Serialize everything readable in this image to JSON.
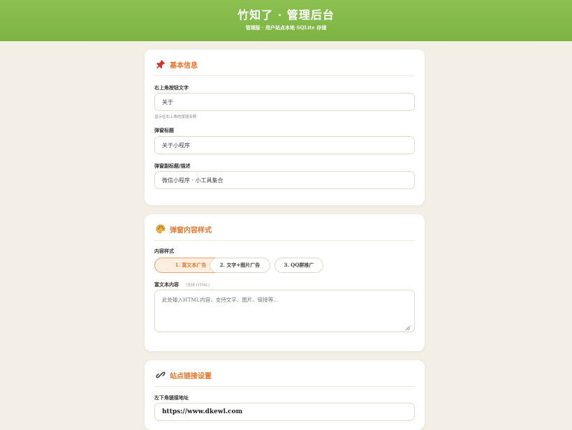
{
  "header": {
    "title": "竹知了 · 管理后台",
    "subtitle": "管理版 · 用户站点本地 SQLite 存储"
  },
  "basic": {
    "section_title": "基本信息",
    "section_icon": "pushpin-icon",
    "btn_text_label": "右上角按钮文字",
    "btn_text_value": "关于",
    "btn_text_hint": "显示在右上角的按钮名称",
    "popup_title_label": "弹窗标题",
    "popup_title_value": "关于小程序",
    "popup_sub_label": "弹窗副标题/描述",
    "popup_sub_value": "微信小程序 · 小工具集合"
  },
  "popup": {
    "section_title": "弹窗内容样式",
    "section_icon": "palette-icon",
    "style_label": "内容样式",
    "options": [
      "1. 富文本广告",
      "2. 文字+图片广告",
      "3. QQ群推广"
    ],
    "selected": 0,
    "rich_label": "富文本内容",
    "rich_hint": "（支持 HTML）",
    "rich_placeholder": "此处输入HTML内容，支持文字、图片、链接等..."
  },
  "links": {
    "section_title": "站点链接设置",
    "section_icon": "link-icon",
    "url_label": "左下角链接地址",
    "url_value": "https://www.dkewl.com"
  },
  "colors": {
    "header_green": "#7cb342",
    "accent_orange": "#e8762a",
    "page_bg": "#f3efe7"
  }
}
